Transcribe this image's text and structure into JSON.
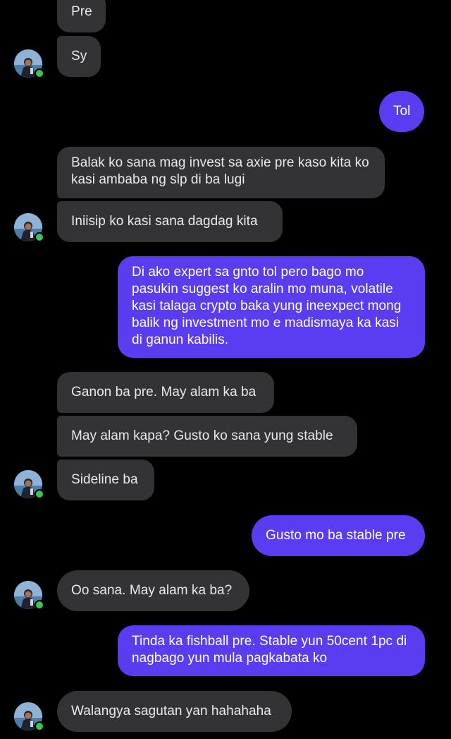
{
  "conversation": {
    "messages": [
      {
        "from": "friend",
        "text": "Pre"
      },
      {
        "from": "friend",
        "text": "Sy"
      },
      {
        "from": "me",
        "text": "Tol"
      },
      {
        "from": "friend",
        "text": "Balak ko sana mag invest sa axie pre kaso kita ko kasi ambaba ng slp di ba lugi"
      },
      {
        "from": "friend",
        "text": "Iniisip ko kasi sana dagdag kita"
      },
      {
        "from": "me",
        "text": "Di ako expert sa gnto tol pero bago mo pasukin suggest ko aralin mo muna, volatile kasi talaga crypto baka yung ineexpect mong balik ng investment mo e madismaya ka kasi di ganun kabilis."
      },
      {
        "from": "friend",
        "text": "Ganon ba pre. May alam ka ba"
      },
      {
        "from": "friend",
        "text": "May alam kapa? Gusto ko sana yung stable"
      },
      {
        "from": "friend",
        "text": "Sideline ba"
      },
      {
        "from": "me",
        "text": "Gusto mo ba stable pre"
      },
      {
        "from": "friend",
        "text": "Oo sana. May alam ka ba?"
      },
      {
        "from": "me",
        "text": "Tinda ka fishball pre. Stable yun 50cent 1pc di nagbago yun mula pagkabata ko"
      },
      {
        "from": "friend",
        "text": "Walangya sagutan yan hahahaha"
      }
    ]
  },
  "colors": {
    "incoming_bubble": "#333335",
    "outgoing_bubble": "#5a3df0",
    "background": "#000000",
    "online_dot": "#3cc35a"
  },
  "icons": {
    "avatar": "friend-avatar-photo",
    "presence": "online-status-dot"
  }
}
